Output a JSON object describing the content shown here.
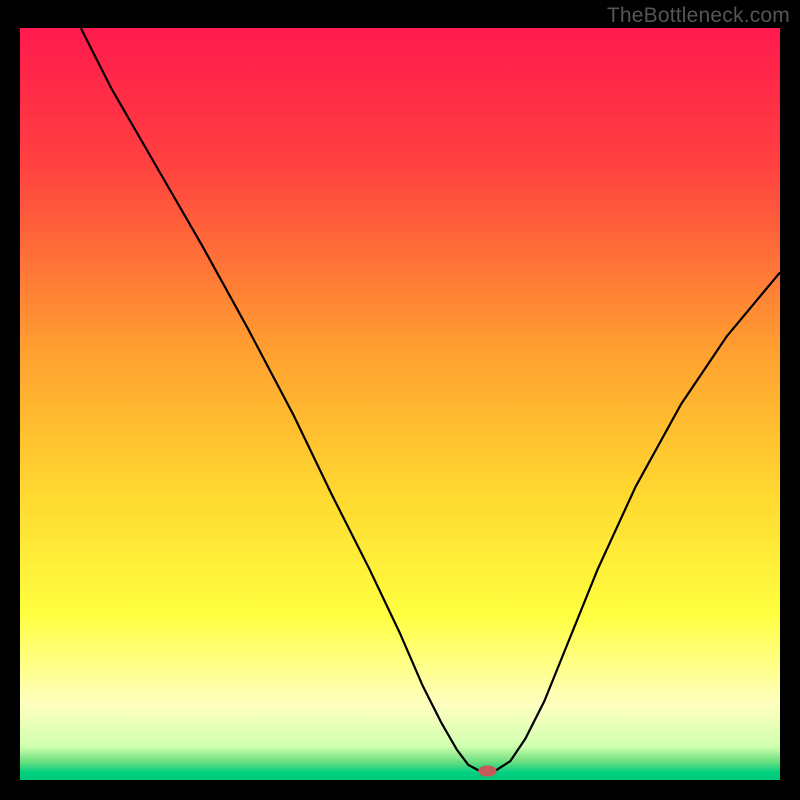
{
  "watermark": "TheBottleneck.com",
  "chart_data": {
    "type": "line",
    "title": "",
    "xlabel": "",
    "ylabel": "",
    "xlim": [
      0,
      100
    ],
    "ylim": [
      0,
      100
    ],
    "grid": false,
    "legend": false,
    "background_gradient": {
      "stops": [
        {
          "offset": 0.0,
          "color": "#ff1a4d"
        },
        {
          "offset": 0.18,
          "color": "#ff4040"
        },
        {
          "offset": 0.43,
          "color": "#ffa030"
        },
        {
          "offset": 0.62,
          "color": "#ffd830"
        },
        {
          "offset": 0.78,
          "color": "#ffff40"
        },
        {
          "offset": 0.9,
          "color": "#ffffc0"
        },
        {
          "offset": 0.955,
          "color": "#d0ffb0"
        },
        {
          "offset": 0.975,
          "color": "#70e080"
        },
        {
          "offset": 0.99,
          "color": "#00d080"
        },
        {
          "offset": 1.0,
          "color": "#00c878"
        }
      ]
    },
    "series": [
      {
        "name": "bottleneck-curve",
        "stroke": "#000000",
        "stroke_width": 2.2,
        "x": [
          8,
          12,
          18,
          24,
          30,
          36,
          41,
          46,
          50,
          53,
          55.5,
          57.5,
          59,
          60.5,
          62.5,
          64.5,
          66.5,
          69,
          72,
          76,
          81,
          87,
          93,
          100
        ],
        "y": [
          100,
          92,
          81.5,
          71,
          60,
          48.5,
          38,
          28,
          19.5,
          12.5,
          7.5,
          4,
          2,
          1.2,
          1.2,
          2.5,
          5.5,
          10.5,
          18,
          28,
          39,
          50,
          59,
          67.5
        ]
      }
    ],
    "marker": {
      "name": "optimal-point",
      "x": 61.5,
      "y": 1.2,
      "rx": 1.2,
      "ry": 0.75,
      "color": "#c65a5a"
    }
  }
}
